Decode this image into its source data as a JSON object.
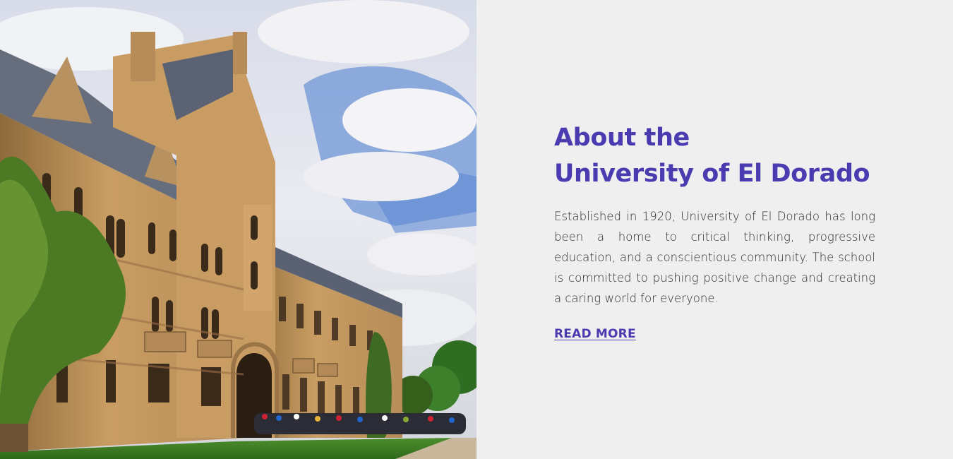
{
  "photo": {
    "icon_name": "university-building-photo",
    "accent_sky": "#8fb0dd",
    "accent_stone": "#c59a62"
  },
  "about": {
    "title_line1": "About the",
    "title_line2": "University of El Dorado",
    "description": "Established in 1920, University of El Dorado has long been a home to critical thinking, progressive education, and a conscientious community. The school is committed to pushing positive change and creating a caring world for everyone.",
    "read_more_label": "READ MORE ",
    "accent_color": "#4a3bb1",
    "background_color": "#efefef"
  }
}
